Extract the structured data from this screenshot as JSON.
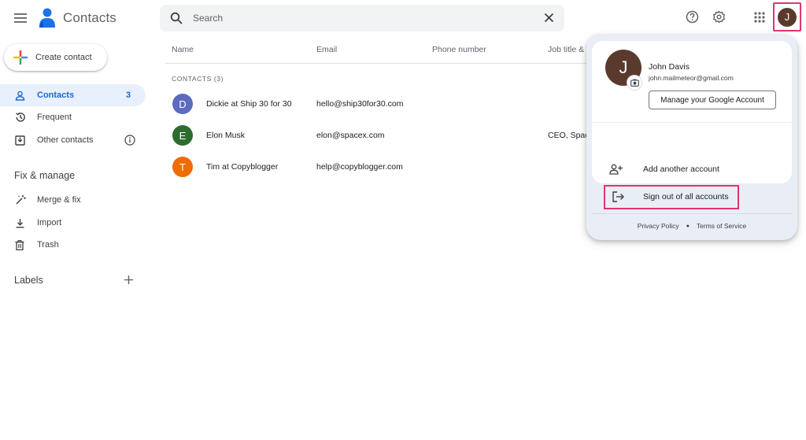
{
  "app": {
    "title": "Contacts"
  },
  "search": {
    "placeholder": "Search",
    "value": ""
  },
  "top_icons": [
    "menu-icon",
    "help-icon",
    "settings-icon",
    "apps-grid-icon"
  ],
  "user": {
    "initial": "J"
  },
  "sidebar": {
    "create_label": "Create contact",
    "nav": [
      {
        "label": "Contacts",
        "count": "3",
        "icon": "person-icon",
        "active": true
      },
      {
        "label": "Frequent",
        "icon": "history-icon"
      },
      {
        "label": "Other contacts",
        "icon": "inbox-icon",
        "info_icon": true
      }
    ],
    "fix_manage_title": "Fix & manage",
    "fix_items": [
      {
        "label": "Merge & fix",
        "icon": "magic-wand-icon"
      },
      {
        "label": "Import",
        "icon": "download-icon"
      },
      {
        "label": "Trash",
        "icon": "trash-icon"
      }
    ],
    "labels_title": "Labels"
  },
  "table": {
    "columns": [
      "Name",
      "Email",
      "Phone number",
      "Job title &"
    ],
    "count_label": "CONTACTS (3)",
    "rows": [
      {
        "initial": "D",
        "color": "#5c6bc0",
        "name": "Dickie at Ship 30 for 30",
        "email": "hello@ship30for30.com",
        "phone": "",
        "job": ""
      },
      {
        "initial": "E",
        "color": "#2e6b2f",
        "name": "Elon Musk",
        "email": "elon@spacex.com",
        "phone": "",
        "job": "CEO, Space"
      },
      {
        "initial": "T",
        "color": "#ef6c00",
        "name": "Tim at Copyblogger",
        "email": "help@copyblogger.com",
        "phone": "",
        "job": ""
      }
    ]
  },
  "account_popup": {
    "initial": "J",
    "name": "John Davis",
    "email": "john.mailmeteor@gmail.com",
    "manage_label": "Manage your Google Account",
    "add_account_label": "Add another account",
    "sign_out_label": "Sign out of all accounts",
    "privacy_label": "Privacy Policy",
    "terms_label": "Terms of Service"
  },
  "colors": {
    "highlight": "#e0356b",
    "active_nav_bg": "#e8f0fe",
    "active_nav_text": "#1967d2",
    "avatar_bg": "#5b3a2e"
  }
}
